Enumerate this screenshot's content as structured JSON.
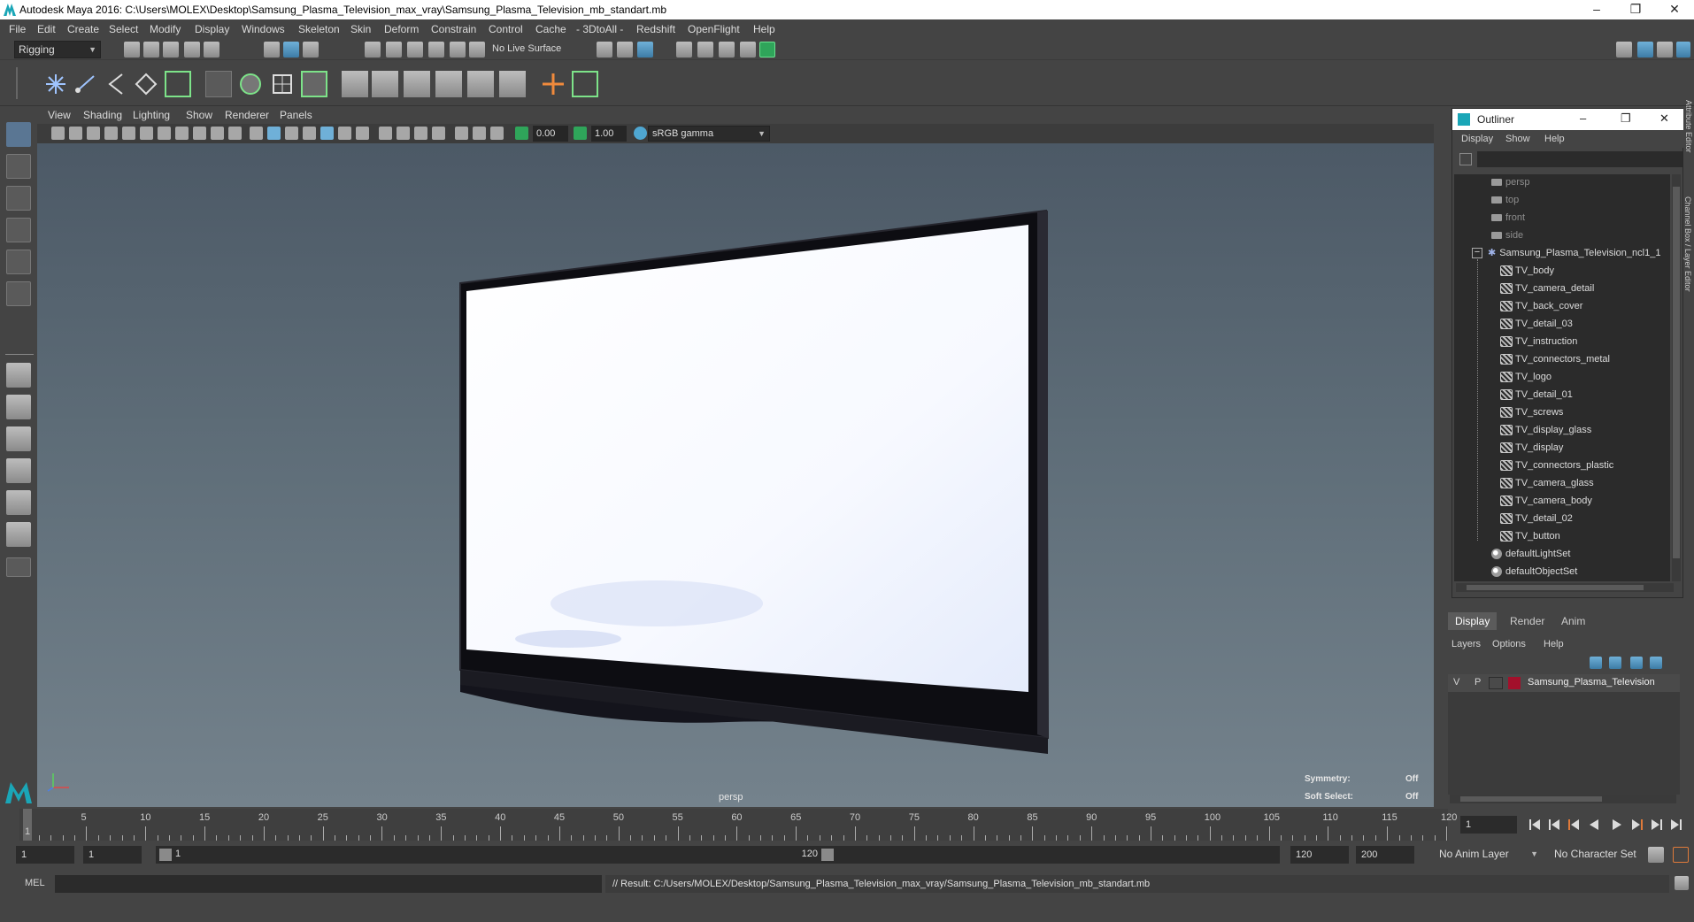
{
  "window": {
    "title": "Autodesk Maya 2016: C:\\Users\\MOLEX\\Desktop\\Samsung_Plasma_Television_max_vray\\Samsung_Plasma_Television_mb_standart.mb",
    "minimize": "–",
    "maximize": "❐",
    "close": "✕"
  },
  "menu": [
    "File",
    "Edit",
    "Create",
    "Select",
    "Modify",
    "Display",
    "Windows",
    "Skeleton",
    "Skin",
    "Deform",
    "Constrain",
    "Control",
    "Cache",
    "- 3DtoAll -",
    "Redshift",
    "OpenFlight",
    "Help"
  ],
  "statusline": {
    "mode": "Rigging",
    "live_surface": "No Live Surface"
  },
  "panel_menu": [
    "View",
    "Shading",
    "Lighting",
    "Show",
    "Renderer",
    "Panels"
  ],
  "panel_toolbar": {
    "exposure": "0.00",
    "gamma": "1.00",
    "color_space": "sRGB gamma"
  },
  "viewport": {
    "camera": "persp",
    "symmetry_label": "Symmetry:",
    "symmetry_value": "Off",
    "soft_select_label": "Soft Select:",
    "soft_select_value": "Off"
  },
  "outliner": {
    "title": "Outliner",
    "menu": [
      "Display",
      "Show",
      "Help"
    ],
    "cameras": [
      "persp",
      "top",
      "front",
      "side"
    ],
    "group": "Samsung_Plasma_Television_ncl1_1",
    "children": [
      "TV_body",
      "TV_camera_detail",
      "TV_back_cover",
      "TV_detail_03",
      "TV_instruction",
      "TV_connectors_metal",
      "TV_logo",
      "TV_detail_01",
      "TV_screws",
      "TV_display_glass",
      "TV_display",
      "TV_connectors_plastic",
      "TV_camera_glass",
      "TV_camera_body",
      "TV_detail_02",
      "TV_button"
    ],
    "sets": [
      "defaultLightSet",
      "defaultObjectSet"
    ]
  },
  "side_tabs": {
    "attribute_editor": "Attribute Editor",
    "channel_box": "Channel Box / Layer Editor"
  },
  "layers": {
    "tabs": [
      "Display",
      "Render",
      "Anim"
    ],
    "menu": [
      "Layers",
      "Options",
      "Help"
    ],
    "row": {
      "v": "V",
      "p": "P",
      "name": "Samsung_Plasma_Television",
      "color": "#a3102b"
    }
  },
  "timeline": {
    "ticks": [
      "5",
      "10",
      "15",
      "20",
      "25",
      "30",
      "35",
      "40",
      "45",
      "50",
      "55",
      "60",
      "65",
      "70",
      "75",
      "80",
      "85",
      "90",
      "95",
      "100",
      "105",
      "110",
      "115",
      "120"
    ],
    "start_tick": "1",
    "current_frame": "1"
  },
  "range": {
    "start": "1",
    "playback_start": "1",
    "range_start_label": "1",
    "range_end_label": "120",
    "playback_end": "120",
    "end": "200",
    "anim_layer": "No Anim Layer",
    "character_set": "No Character Set"
  },
  "command": {
    "lang": "MEL",
    "result": "// Result: C:/Users/MOLEX/Desktop/Samsung_Plasma_Television_max_vray/Samsung_Plasma_Television_mb_standart.mb"
  },
  "colors": {
    "accent": "#1aa6b7",
    "layer_color": "#a3102b"
  }
}
